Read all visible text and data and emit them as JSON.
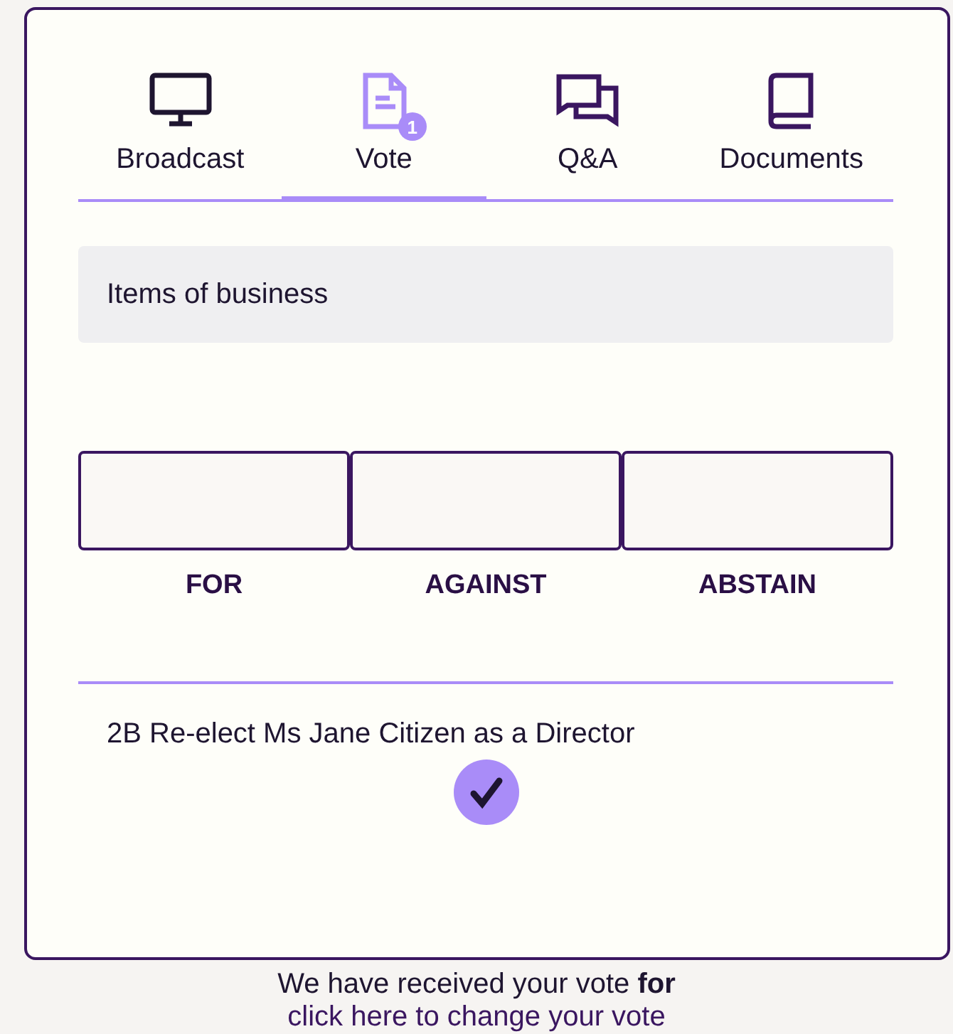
{
  "tabs": [
    {
      "kind": "monitor",
      "label": "Broadcast",
      "selected": false
    },
    {
      "kind": "document",
      "label": "Vote",
      "selected": true,
      "badge": "1"
    },
    {
      "kind": "chat",
      "label": "Q&A",
      "selected": false
    },
    {
      "kind": "book",
      "label": "Documents",
      "selected": false
    }
  ],
  "section_header": "Items of business",
  "vote_options": [
    "FOR",
    "AGAINST",
    "ABSTAIN"
  ],
  "resolution": {
    "title": "2B Re-elect Ms Jane Citizen as a Director",
    "voted": true
  },
  "message": "We have received your vote **for**",
  "change_link": "click here to change your vote"
}
